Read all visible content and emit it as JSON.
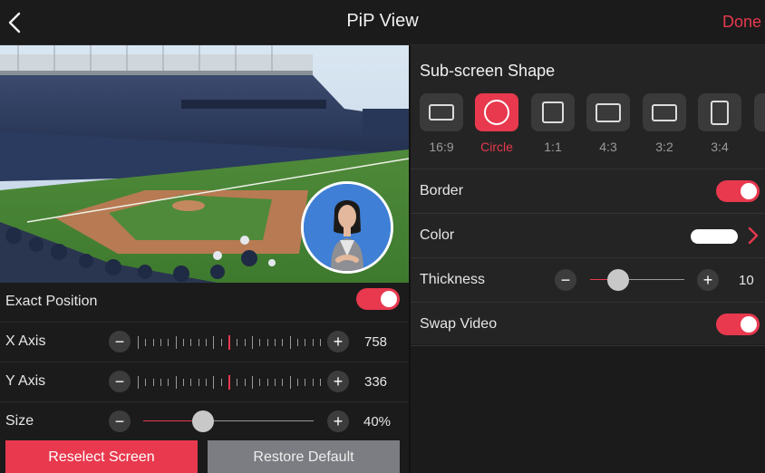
{
  "header": {
    "title": "PiP View",
    "done_label": "Done",
    "back_icon": "chevron-left-icon"
  },
  "preview": {
    "description_icon": "stadium-video",
    "pip_icon": "presenter-video"
  },
  "left_controls": {
    "exact_position": {
      "label": "Exact Position",
      "on": true
    },
    "x_axis": {
      "label": "X Axis",
      "value": "758",
      "minus": "−",
      "plus": "+"
    },
    "y_axis": {
      "label": "Y Axis",
      "value": "336",
      "minus": "−",
      "plus": "+"
    },
    "size": {
      "label": "Size",
      "value": "40%",
      "minus": "−",
      "plus": "+",
      "level": 0.35
    },
    "reselect_label": "Reselect Screen",
    "restore_label": "Restore Default"
  },
  "right_panel": {
    "section_title": "Sub-screen Shape",
    "shapes": [
      {
        "label": "16:9",
        "selected": false
      },
      {
        "label": "Circle",
        "selected": true
      },
      {
        "label": "1:1",
        "selected": false
      },
      {
        "label": "4:3",
        "selected": false
      },
      {
        "label": "3:2",
        "selected": false
      },
      {
        "label": "3:4",
        "selected": false
      }
    ],
    "border": {
      "label": "Border",
      "on": true
    },
    "color": {
      "label": "Color",
      "value": "#ffffff"
    },
    "thickness": {
      "label": "Thickness",
      "value": "10",
      "minus": "−",
      "plus": "+",
      "level": 0.3
    },
    "swap_video": {
      "label": "Swap Video",
      "on": true
    }
  },
  "colors": {
    "accent": "#e8394e",
    "background": "#1b1b1b",
    "panel": "#242424",
    "secondary_button": "#7b7d82"
  }
}
